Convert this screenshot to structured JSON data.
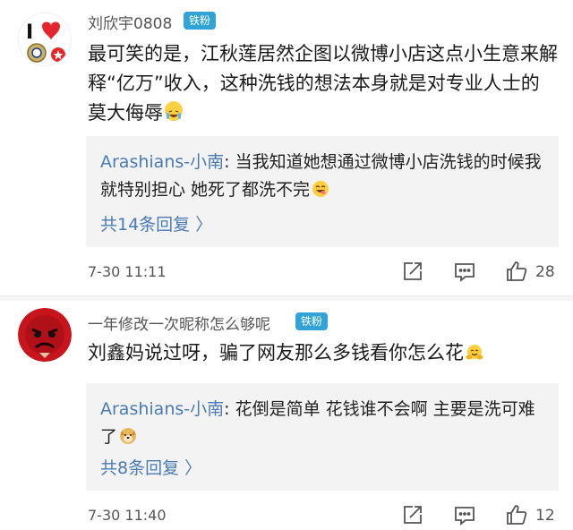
{
  "comments": [
    {
      "username": "刘欣宇0808",
      "badge": "铁粉",
      "text": "最可笑的是，江秋莲居然企图以微博小店这点小生意来解释“亿万”收入，这种洗钱的想法本身就是对专业人士的莫大侮辱",
      "emoji": "crying-laugh-emoji",
      "reply": {
        "author": "Arashians-小南",
        "separator": ":",
        "text": "当我知道她想通过微博小店洗钱的时候我就特别担心 她死了都洗不完",
        "emoji": "grin-tongue-emoji",
        "more": "共14条回复 〉"
      },
      "time": "7-30 11:11",
      "likes": "28",
      "avatar_text": "I",
      "avatar_heart_color": "#e4262c"
    },
    {
      "username": "一年修改一次昵称怎么够呢",
      "badge": "铁粉",
      "text": "刘鑫妈说过呀，骗了网友那么多钱看你怎么花",
      "emoji": "hug-emoji",
      "reply": {
        "author": "Arashians-小南",
        "separator": ":",
        "text": "花倒是简单 花钱谁不会啊 主要是洗可难了",
        "emoji": "doge-emoji",
        "more": "共8条回复 〉"
      },
      "time": "7-30 11:40",
      "likes": "12",
      "avatar_color": "#c8141c"
    }
  ],
  "colors": {
    "badge": "#31a3d6",
    "link": "#4a7bb7",
    "reply_bg": "#f3f3f3"
  }
}
